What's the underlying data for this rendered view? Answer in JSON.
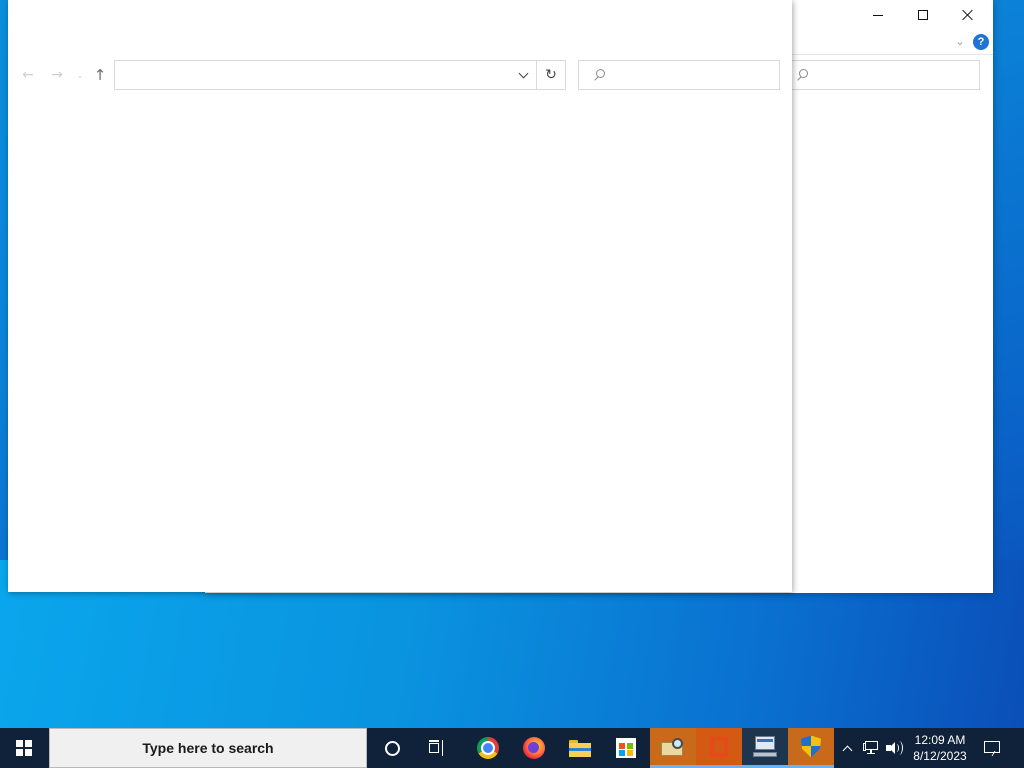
{
  "desktop": {
    "colors": {
      "wallpaper": "#0a84d8",
      "taskbar": "#10223a"
    }
  },
  "back_window": {
    "controls": [
      "minimize-icon",
      "maximize-icon",
      "close-icon"
    ],
    "help_label": "?",
    "search_placeholder": ""
  },
  "front_window": {
    "nav": {
      "back": "←",
      "forward": "→",
      "recent": "⌄",
      "up": "↑"
    },
    "address": {
      "value": "",
      "refresh": "↻"
    },
    "search": {
      "placeholder": ""
    }
  },
  "taskbar": {
    "search_text": "Type here to search",
    "pinned": [
      {
        "name": "cortana",
        "icon": "cortana-icon"
      },
      {
        "name": "task-view",
        "icon": "task-view-icon"
      },
      {
        "name": "chrome",
        "icon": "chrome-icon"
      },
      {
        "name": "firefox",
        "icon": "firefox-icon"
      },
      {
        "name": "file-explorer",
        "icon": "folder-icon"
      },
      {
        "name": "microsoft-store",
        "icon": "store-icon"
      },
      {
        "name": "app-folder-search",
        "icon": "folder-magnifier-icon",
        "state": "active"
      },
      {
        "name": "office",
        "icon": "office-icon",
        "state": "active"
      },
      {
        "name": "network-app",
        "icon": "network-computer-icon",
        "state": "running"
      },
      {
        "name": "security-app",
        "icon": "shield-icon",
        "state": "active"
      }
    ],
    "tray": {
      "time": "12:09 AM",
      "date": "8/12/2023"
    }
  }
}
